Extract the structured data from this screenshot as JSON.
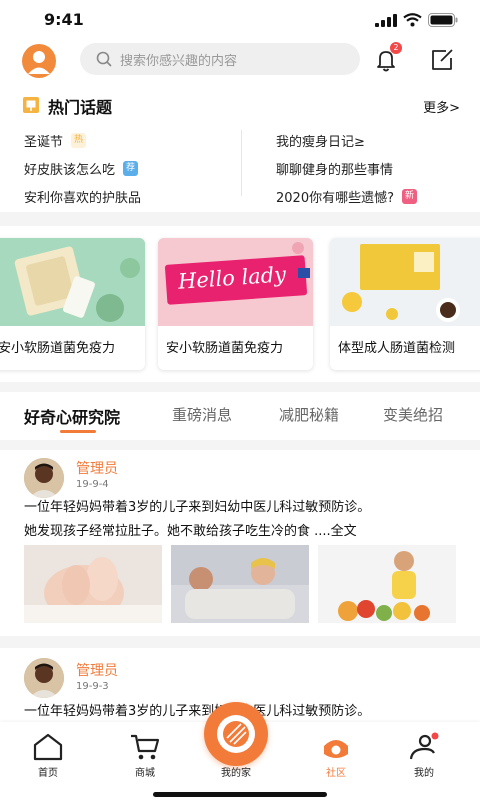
{
  "status": {
    "time": "9:41"
  },
  "search": {
    "placeholder": "搜索你感兴趣的内容"
  },
  "notifications": {
    "badge": "2"
  },
  "hot_topics": {
    "title": "热门话题",
    "more": "更多>",
    "left": [
      {
        "text": "圣诞节",
        "tag": "热",
        "tag_color": "#f5b341"
      },
      {
        "text": "好皮肤该怎么吃",
        "tag": "荐",
        "tag_color": "#5aaeea"
      },
      {
        "text": "安利你喜欢的护肤品",
        "tag": "",
        "tag_color": ""
      }
    ],
    "right": [
      {
        "text": "我的瘦身日记≥",
        "tag": "",
        "tag_color": ""
      },
      {
        "text": "聊聊健身的那些事情",
        "tag": "",
        "tag_color": ""
      },
      {
        "text": "2020你有哪些遗憾?",
        "tag": "新",
        "tag_color": "#ef5f82"
      }
    ]
  },
  "cards": [
    {
      "label": "安小软肠道菌免疫力",
      "banner_text": ""
    },
    {
      "label": "安小软肠道菌免疫力",
      "banner_text": "Hello lady"
    },
    {
      "label": "体型成人肠道菌检测",
      "banner_text": ""
    }
  ],
  "tabs": [
    "好奇心研究院",
    "重磅消息",
    "减肥秘籍",
    "变美绝招"
  ],
  "posts": [
    {
      "author": "管理员",
      "date": "19-9-4",
      "line1": "一位年轻妈妈带着3岁的儿子来到妇幼中医儿科过敏预防诊。",
      "line2": "她发现孩子经常拉肚子。她不敢给孩子吃生冷的食 ....全文"
    },
    {
      "author": "管理员",
      "date": "19-9-3",
      "line1": "一位年轻妈妈带着3岁的儿子来到妇幼中医儿科过敏预防诊。"
    }
  ],
  "nav": [
    "首页",
    "商城",
    "我的家",
    "社区",
    "我的"
  ],
  "colors": {
    "accent": "#f27b3a",
    "badge": "#f24848"
  }
}
